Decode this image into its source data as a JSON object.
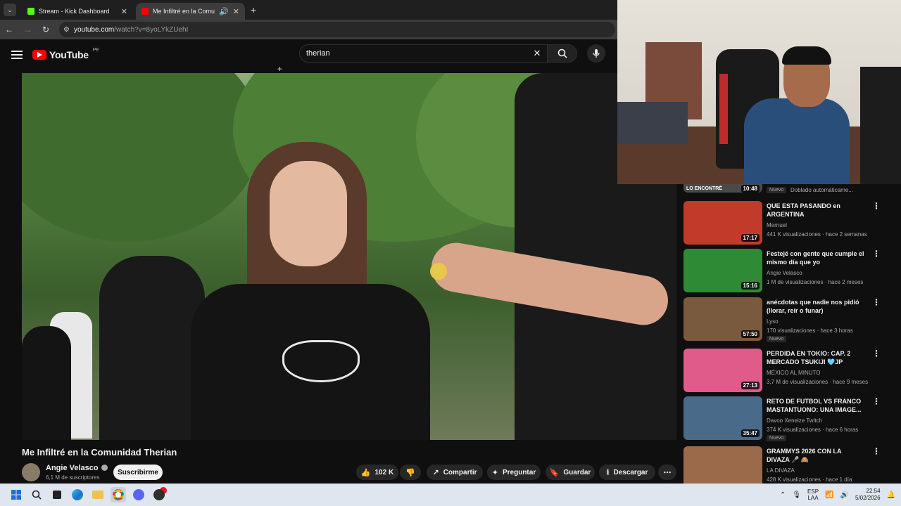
{
  "browser": {
    "tabs": [
      {
        "title": "Stream - Kick Dashboard",
        "favicon_color": "#53fc18"
      },
      {
        "title": "Me Infiltré en la Comunidad",
        "favicon_color": "#ff0000"
      }
    ],
    "url_host": "youtube.com",
    "url_path": "/watch?v=8yoLYkZUehI"
  },
  "youtube": {
    "logo_text": "YouTube",
    "region": "PE",
    "search_query": "therian"
  },
  "video": {
    "title": "Me Infiltré en la Comunidad Therian",
    "channel": "Angie Velasco",
    "subscribers": "6,1 M de suscriptores",
    "subscribe_label": "Suscribirme",
    "likes": "102 K",
    "share_label": "Compartir",
    "ask_label": "Preguntar",
    "save_label": "Guardar",
    "download_label": "Descargar"
  },
  "sidebar": {
    "partial_row": {
      "thumb_text": "LO ENCONTRÉ",
      "duration": "10:48",
      "badge": "Nuevo",
      "dub": "Doblado automáticame..."
    },
    "items": [
      {
        "title": "QUE ESTA PASANDO en ARGENTINA",
        "channel": "Mernuel",
        "meta": "441 K visualizaciones · hace 2 semanas",
        "duration": "17:17",
        "badge": "",
        "thumb_color": "#c23a2a"
      },
      {
        "title": "Festejé con gente que cumple el mismo día que yo",
        "channel": "Angie Velasco",
        "meta": "1 M de visualizaciones · hace 2 meses",
        "duration": "15:16",
        "badge": "",
        "thumb_color": "#2f8a35"
      },
      {
        "title": "anécdotas que nadie nos pidió (llorar, reír o funar)",
        "channel": "Lyso",
        "meta": "170 visualizaciones · hace 3 horas",
        "duration": "57:50",
        "badge": "Nuevo",
        "thumb_color": "#7a5a3e"
      },
      {
        "title": "PERDIDA EN TOKIO: CAP. 2 MERCADO TSUKIJI 🩵JP",
        "channel": "MÉXICO AL MINUTO",
        "meta": "3,7 M de visualizaciones · hace 9 meses",
        "duration": "27:13",
        "badge": "",
        "thumb_color": "#e05a8a"
      },
      {
        "title": "RETO DE FUTBOL VS FRANCO MASTANTUONO: UNA IMAGE...",
        "channel": "Davoo Xeneize Twitch",
        "meta": "374 K visualizaciones · hace 6 horas",
        "duration": "35:47",
        "badge": "Nuevo",
        "thumb_color": "#4a6a8a"
      },
      {
        "title": "GRAMMYS 2026 CON LA DIVAZA 🎤 🙈",
        "channel": "LA DIVAZA",
        "meta": "428 K visualizaciones · hace 1 día",
        "duration": "",
        "badge": "",
        "thumb_color": "#9a6a4a"
      }
    ]
  },
  "taskbar": {
    "lang_top": "ESP",
    "lang_bottom": "LAA",
    "time": "22:54",
    "date": "5/02/2026"
  }
}
